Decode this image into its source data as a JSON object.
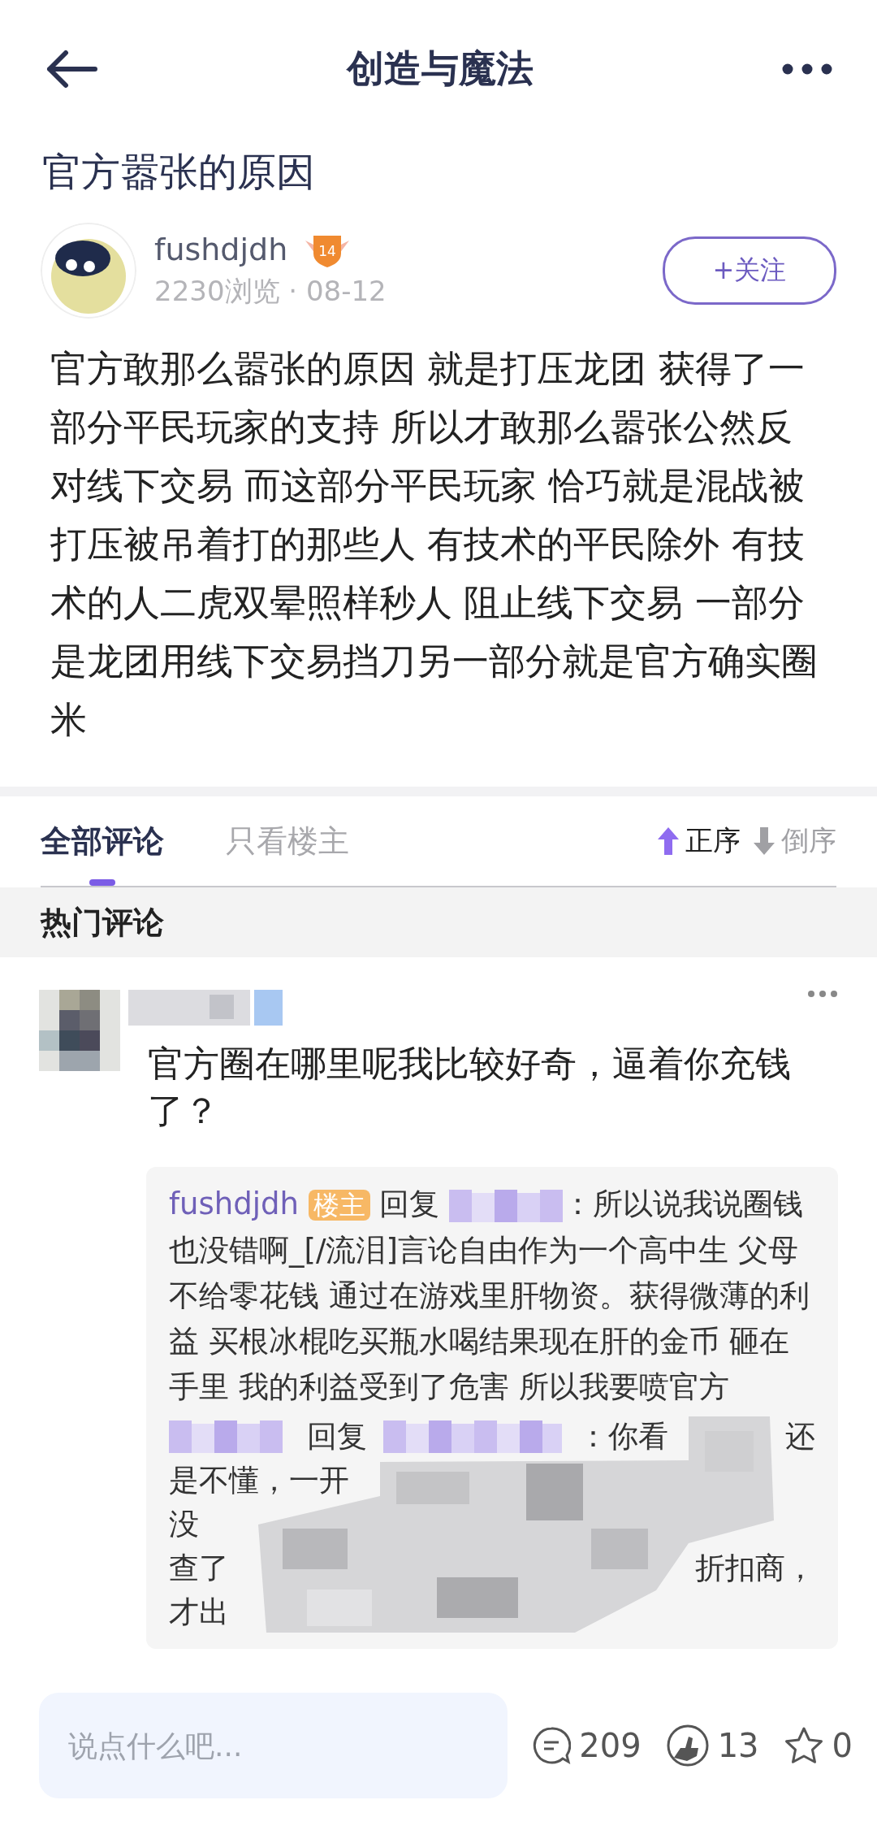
{
  "header": {
    "title": "创造与魔法"
  },
  "post": {
    "title": "官方嚣张的原因",
    "author": "fushdjdh",
    "level": "14",
    "views": "2230浏览",
    "separator": "·",
    "date": "08-12",
    "follow_button": "+关注",
    "body": "官方敢那么嚣张的原因 就是打压龙团 获得了一部分平民玩家的支持 所以才敢那么嚣张公然反对线下交易 而这部分平民玩家 恰巧就是混战被打压被吊着打的那些人 有技术的平民除外 有技术的人二虎双晕照样秒人 阻止线下交易 一部分是龙团用线下交易挡刀另一部分就是官方确实圈米"
  },
  "comment_tabs": [
    {
      "label": "全部评论",
      "selected": true
    },
    {
      "label": "只看楼主",
      "selected": false
    }
  ],
  "sort_options": [
    {
      "label": "正序",
      "selected": true
    },
    {
      "label": "倒序",
      "selected": false
    }
  ],
  "section_title": "热门评论",
  "comments": [
    {
      "text": "官方圈在哪里呢我比较好奇，逼着你充钱了？",
      "replies": [
        {
          "kind": "author",
          "name": "fushdjdh",
          "badge": "楼主",
          "verb": "回复",
          "text": "：所以说我说圈钱也没错啊_[/流泪]言论自由作为一个高中生 父母不给零花钱  通过在游戏里肝物资。获得微薄的利益  买根冰棍吃买瓶水喝结果现在肝的金币 砸在手里 我的利益受到了危害 所以我要喷官方"
        },
        {
          "kind": "obscured",
          "verb": "回复",
          "lines": [
            [
              "：你看",
              "还"
            ],
            [
              "是不懂，一开"
            ],
            [
              "没"
            ],
            [
              "查了",
              "折扣商，"
            ],
            [
              "才出"
            ]
          ]
        }
      ]
    }
  ],
  "bottom_bar": {
    "placeholder": "说点什么吧...",
    "comment_count": "209",
    "like_count": "13",
    "favorite_count": "0"
  }
}
